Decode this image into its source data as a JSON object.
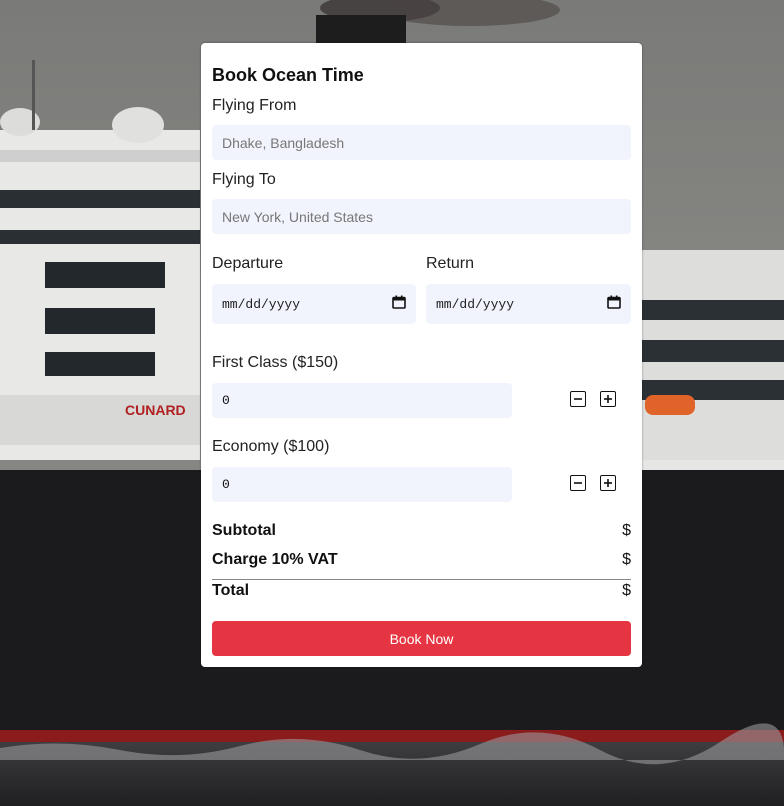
{
  "form": {
    "title": "Book Ocean Time",
    "flying_from": {
      "label": "Flying From",
      "placeholder": "Dhake, Bangladesh",
      "value": ""
    },
    "flying_to": {
      "label": "Flying To",
      "placeholder": "New York, United States",
      "value": ""
    },
    "departure": {
      "label": "Departure",
      "value": "mm/dd/yyyy",
      "icon": "calendar-icon"
    },
    "return": {
      "label": "Return",
      "value": "mm/dd/yyyy",
      "icon": "calendar-icon"
    },
    "first_class": {
      "label": "First Class ($150)",
      "value": "0",
      "decrease_icon": "minus-icon",
      "increase_icon": "plus-icon"
    },
    "economy": {
      "label": "Economy ($100)",
      "value": "0",
      "decrease_icon": "minus-icon",
      "increase_icon": "plus-icon"
    },
    "summary": {
      "subtotal_label": "Subtotal",
      "subtotal_value": "$",
      "vat_label": "Charge 10% VAT",
      "vat_value": "$",
      "total_label": "Total",
      "total_value": "$"
    },
    "book_button": "Book Now"
  },
  "colors": {
    "accent": "#e63542",
    "field_bg": "#f2f4fd",
    "card_bg": "#ffffff"
  }
}
